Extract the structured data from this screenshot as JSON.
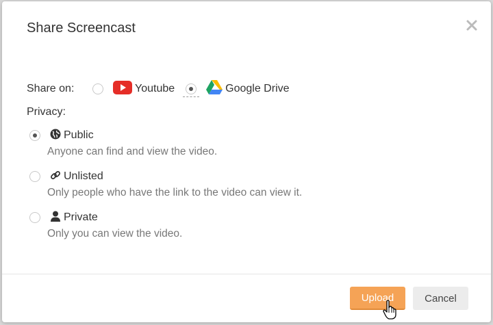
{
  "dialog": {
    "title": "Share Screencast"
  },
  "share": {
    "label": "Share on:",
    "options": [
      {
        "label": "Youtube",
        "icon": "youtube-icon",
        "selected": false
      },
      {
        "label": "Google Drive",
        "icon": "google-drive-icon",
        "selected": true
      }
    ]
  },
  "privacy": {
    "label": "Privacy:",
    "options": [
      {
        "label": "Public",
        "icon": "globe-icon",
        "description": "Anyone can find and view the video.",
        "selected": true
      },
      {
        "label": "Unlisted",
        "icon": "link-icon",
        "description": "Only people who have the link to the video can view it.",
        "selected": false
      },
      {
        "label": "Private",
        "icon": "user-icon",
        "description": "Only you can view the video.",
        "selected": false
      }
    ]
  },
  "buttons": {
    "upload": "Upload",
    "cancel": "Cancel"
  },
  "colors": {
    "upload_bg": "#f5a356",
    "cancel_bg": "#ececec",
    "youtube_red": "#e52d27"
  }
}
